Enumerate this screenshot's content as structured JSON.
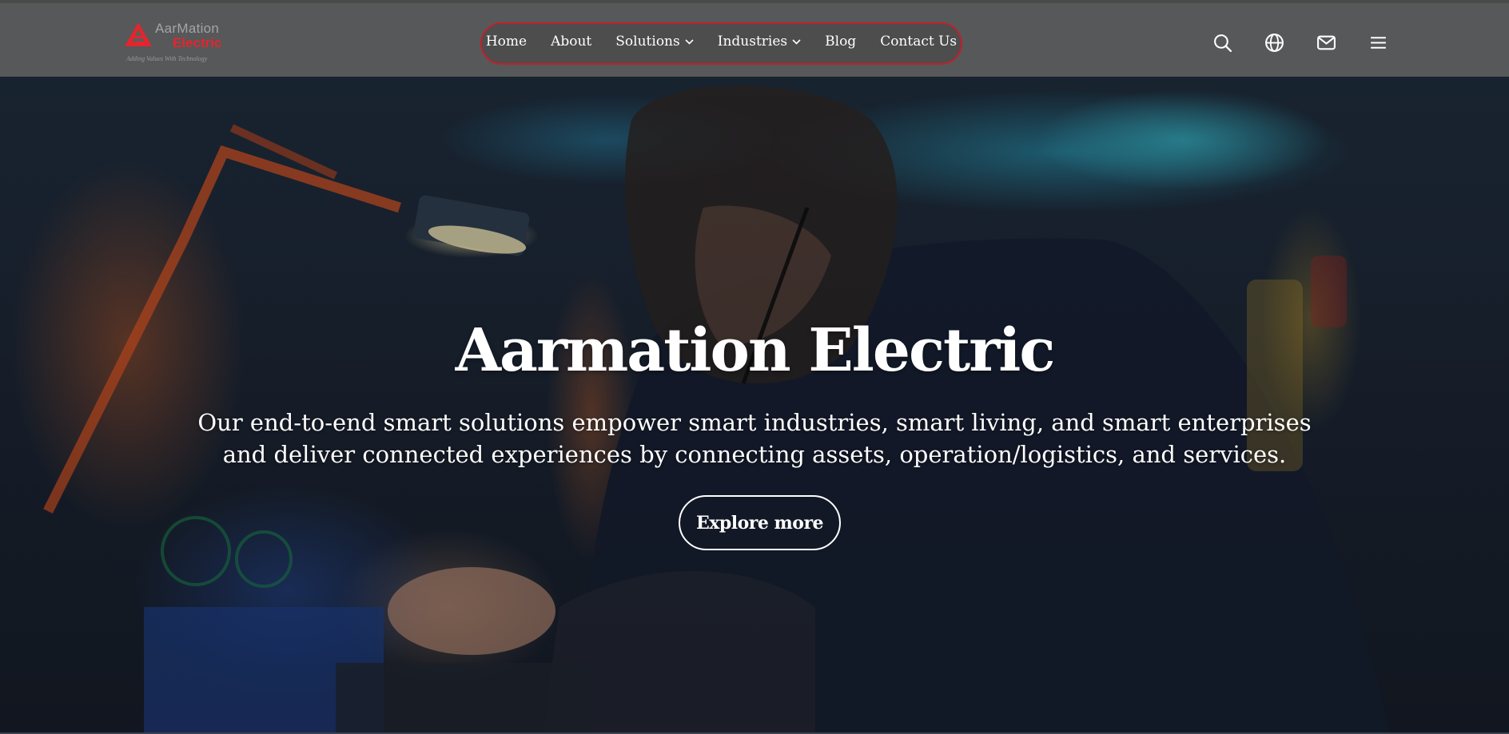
{
  "brand": {
    "name_line1": "AarMation",
    "name_line2": "Electric",
    "tagline": "Adding Values With Technology",
    "accent_color": "#e3252d"
  },
  "nav": {
    "items": [
      {
        "label": "Home",
        "has_dropdown": false
      },
      {
        "label": "About",
        "has_dropdown": false
      },
      {
        "label": "Solutions",
        "has_dropdown": true
      },
      {
        "label": "Industries",
        "has_dropdown": true
      },
      {
        "label": "Blog",
        "has_dropdown": false
      },
      {
        "label": "Contact Us",
        "has_dropdown": false
      }
    ],
    "border_color": "#c0202a"
  },
  "header_actions": [
    {
      "icon": "search-icon"
    },
    {
      "icon": "globe-icon"
    },
    {
      "icon": "mail-icon"
    },
    {
      "icon": "menu-icon"
    }
  ],
  "hero": {
    "title": "Aarmation Electric",
    "subtitle": "Our end-to-end smart solutions empower smart industries, smart living, and smart enterprises and deliver connected experiences by connecting assets, operation/logistics, and services.",
    "cta_label": "Explore more"
  }
}
